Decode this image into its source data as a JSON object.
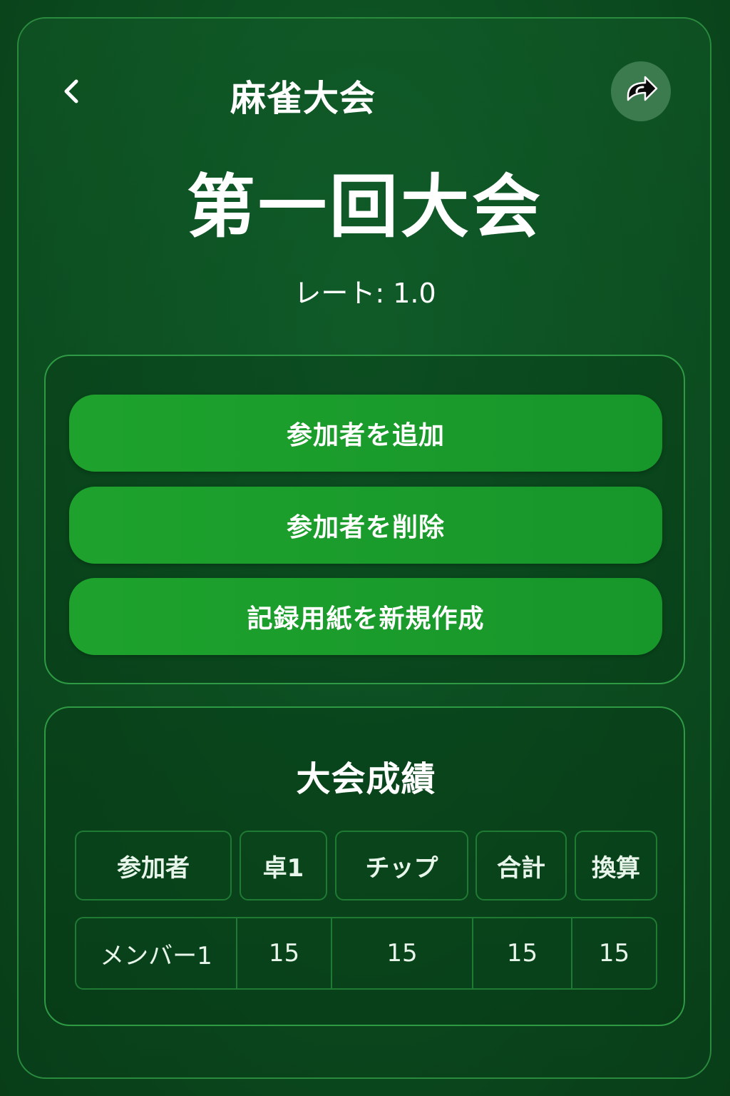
{
  "header": {
    "app_title": "麻雀大会",
    "back_icon": "chevron-left-icon",
    "share_icon": "share-icon"
  },
  "event": {
    "title": "第一回大会",
    "rate_label": "レート: 1.0"
  },
  "actions": [
    {
      "label": "参加者を追加"
    },
    {
      "label": "参加者を削除"
    },
    {
      "label": "記録用紙を新規作成"
    }
  ],
  "results": {
    "title": "大会成績",
    "columns": [
      "参加者",
      "卓1",
      "チップ",
      "合計",
      "換算"
    ],
    "rows": [
      {
        "cells": [
          "メンバー1",
          "15",
          "15",
          "15",
          "15"
        ]
      }
    ]
  },
  "colors": {
    "background": "#0b4a1e",
    "button": "#1ea22d",
    "border": "#2f9a44"
  }
}
